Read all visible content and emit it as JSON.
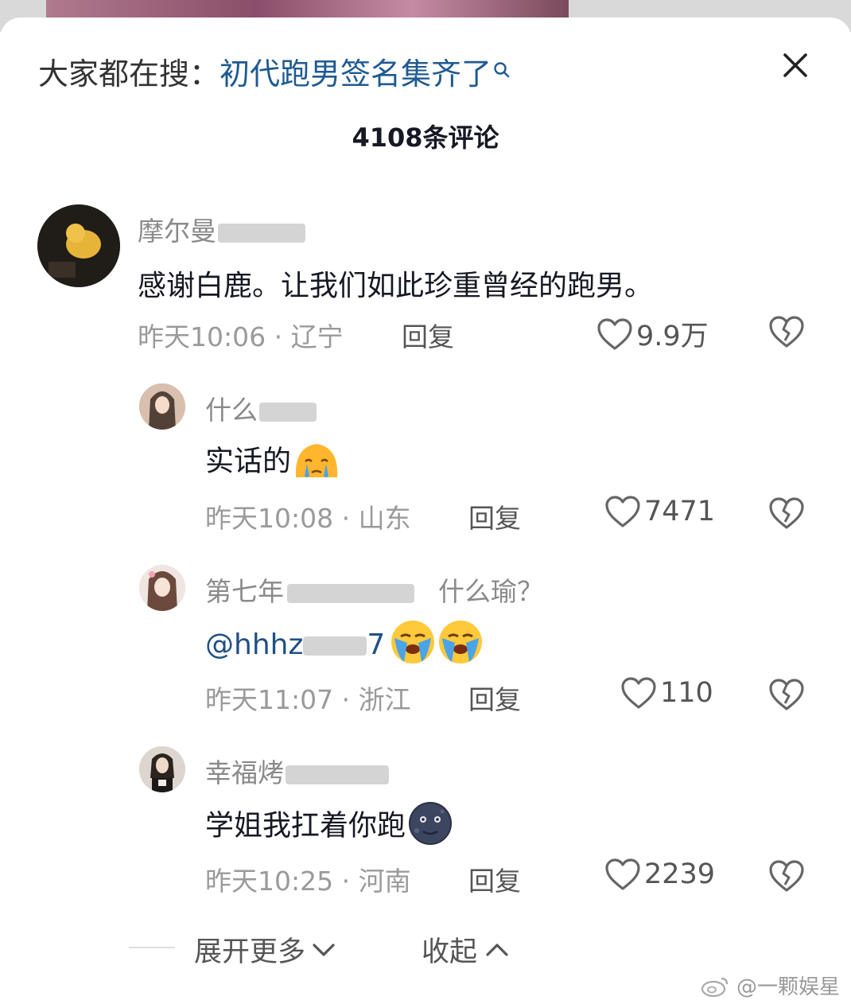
{
  "header": {
    "hot_label": "大家都在搜：",
    "hot_keyword": "初代跑男签名集齐了",
    "comment_count": "4108条评论"
  },
  "comments": [
    {
      "username": "摩尔曼",
      "text": "感谢白鹿。让我们如此珍重曾经的跑男。",
      "time": "昨天10:06 · 辽宁",
      "reply": "回复",
      "likes": "9.9万"
    },
    {
      "username": "什么",
      "text": "实话的",
      "emoji": "crying-face-emoji",
      "time": "昨天10:08 · 山东",
      "reply": "回复",
      "likes": "7471"
    },
    {
      "username": "第七年",
      "username_tail": "什么瑜？",
      "text": "@hhhz",
      "text_tail": "7",
      "emoji": "loudly-crying-face-emoji",
      "time": "昨天11:07 · 浙江",
      "reply": "回复",
      "likes": "110"
    },
    {
      "username": "幸福烤",
      "text": "学姐我扛着你跑",
      "emoji": "new-moon-face-emoji",
      "time": "昨天10:25 · 河南",
      "reply": "回复",
      "likes": "2239"
    }
  ],
  "footer": {
    "expand_label": "展开更多",
    "collapse_label": "收起",
    "watermark": "@一颗娱星"
  },
  "colors": {
    "keyword": "#1f5a92",
    "mention": "#1f4f86",
    "meta": "#9a9a9a"
  }
}
